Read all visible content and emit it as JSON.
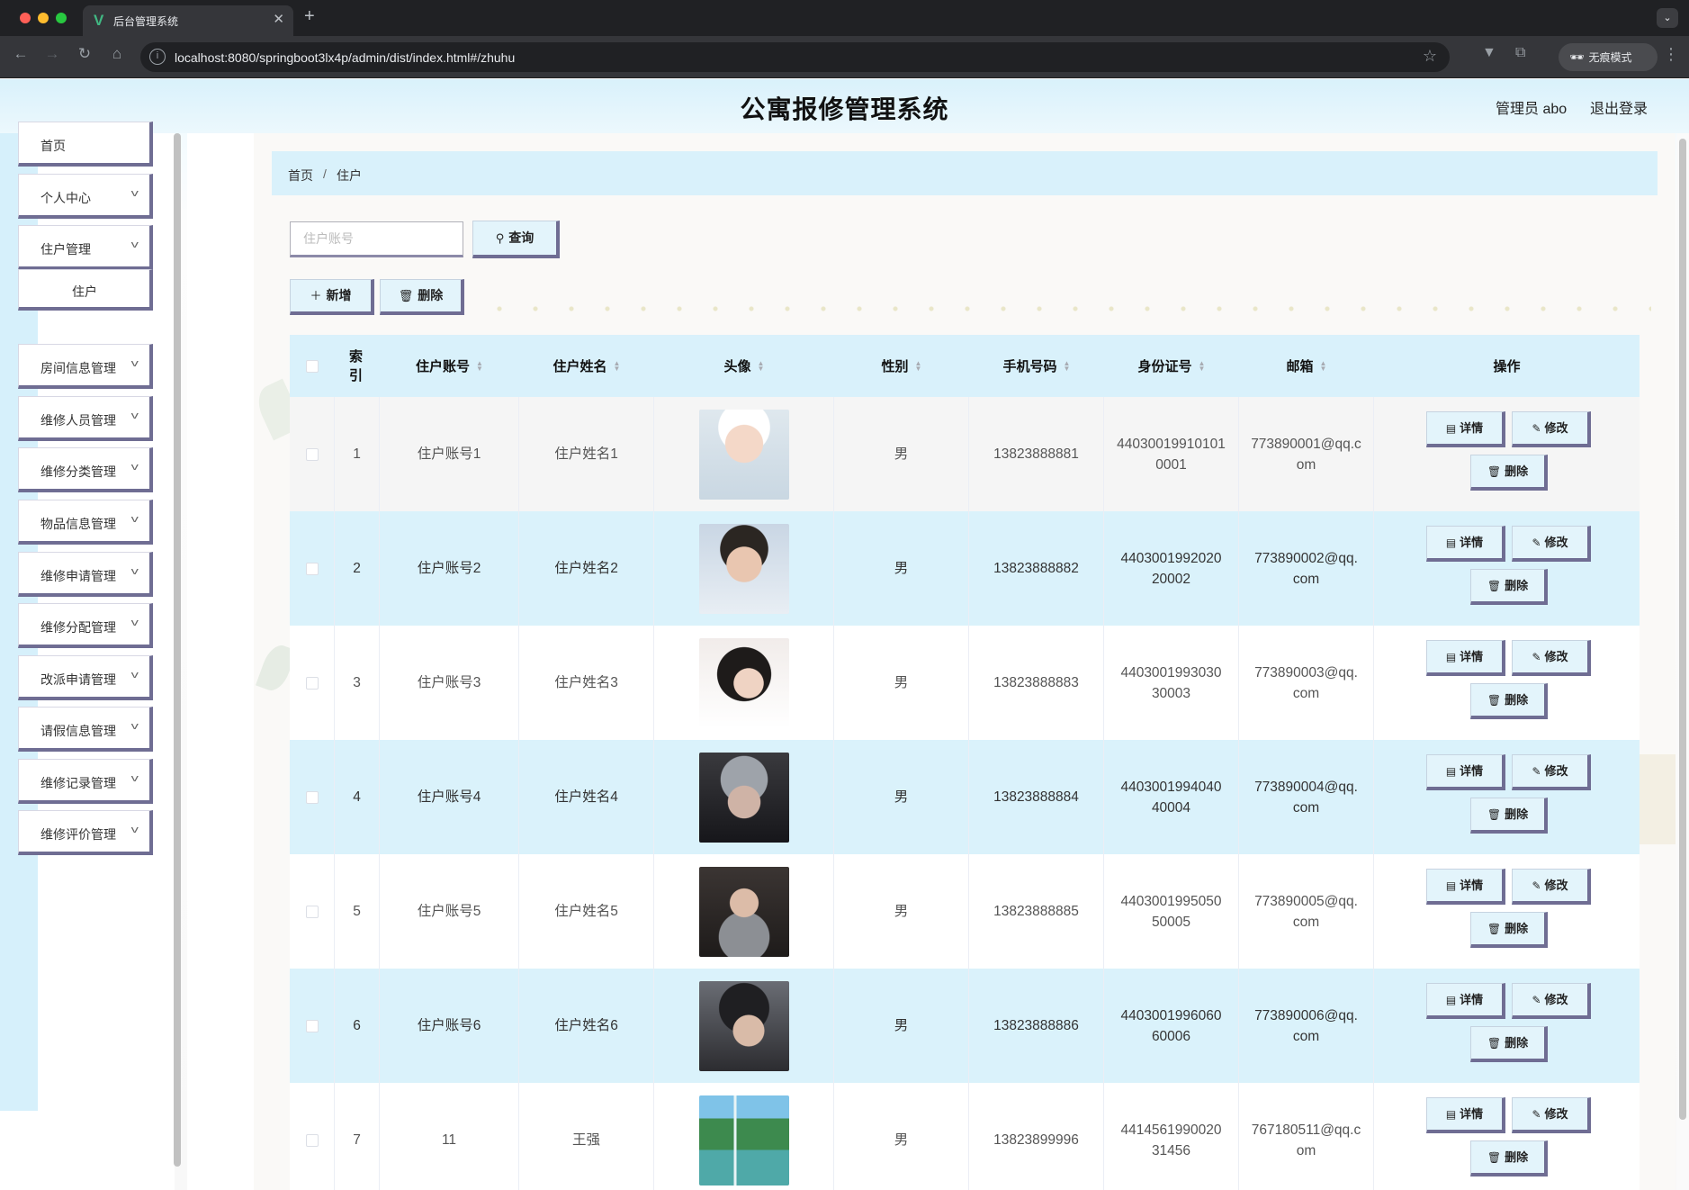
{
  "browser": {
    "tab_title": "后台管理系统",
    "url": "localhost:8080/springboot3lx4p/admin/dist/index.html#/zhuhu",
    "incognito_label": "无痕模式"
  },
  "header": {
    "title": "公寓报修管理系统",
    "user": "管理员 abo",
    "logout": "退出登录"
  },
  "sidebar": {
    "items": [
      {
        "label": "首页"
      },
      {
        "label": "个人中心"
      },
      {
        "label": "住户管理"
      },
      {
        "label": "住户"
      },
      {
        "label": "房间信息管理"
      },
      {
        "label": "维修人员管理"
      },
      {
        "label": "维修分类管理"
      },
      {
        "label": "物品信息管理"
      },
      {
        "label": "维修申请管理"
      },
      {
        "label": "维修分配管理"
      },
      {
        "label": "改派申请管理"
      },
      {
        "label": "请假信息管理"
      },
      {
        "label": "维修记录管理"
      },
      {
        "label": "维修评价管理"
      }
    ]
  },
  "breadcrumb": {
    "home": "首页",
    "sep": "/",
    "current": "住户"
  },
  "search": {
    "placeholder": "住户账号",
    "query_label": "查询"
  },
  "actions": {
    "add_label": "新增",
    "delete_label": "删除"
  },
  "table": {
    "headers": {
      "index": "索引",
      "account": "住户账号",
      "name": "住户姓名",
      "avatar": "头像",
      "gender": "性别",
      "phone": "手机号码",
      "id_card": "身份证号",
      "email": "邮箱",
      "ops": "操作"
    },
    "op_labels": {
      "detail": "详情",
      "edit": "修改",
      "delete": "删除"
    },
    "rows": [
      {
        "index": "1",
        "account": "住户账号1",
        "name": "住户姓名1",
        "gender": "男",
        "phone": "13823888881",
        "id_card_l1": "44030019910101",
        "id_card_l2": "0001",
        "email_l1": "773890001@qq.c",
        "email_l2": "om"
      },
      {
        "index": "2",
        "account": "住户账号2",
        "name": "住户姓名2",
        "gender": "男",
        "phone": "13823888882",
        "id_card_l1": "4403001992020",
        "id_card_l2": "20002",
        "email_l1": "773890002@qq.",
        "email_l2": "com"
      },
      {
        "index": "3",
        "account": "住户账号3",
        "name": "住户姓名3",
        "gender": "男",
        "phone": "13823888883",
        "id_card_l1": "4403001993030",
        "id_card_l2": "30003",
        "email_l1": "773890003@qq.",
        "email_l2": "com"
      },
      {
        "index": "4",
        "account": "住户账号4",
        "name": "住户姓名4",
        "gender": "男",
        "phone": "13823888884",
        "id_card_l1": "4403001994040",
        "id_card_l2": "40004",
        "email_l1": "773890004@qq.",
        "email_l2": "com"
      },
      {
        "index": "5",
        "account": "住户账号5",
        "name": "住户姓名5",
        "gender": "男",
        "phone": "13823888885",
        "id_card_l1": "4403001995050",
        "id_card_l2": "50005",
        "email_l1": "773890005@qq.",
        "email_l2": "com"
      },
      {
        "index": "6",
        "account": "住户账号6",
        "name": "住户姓名6",
        "gender": "男",
        "phone": "13823888886",
        "id_card_l1": "4403001996060",
        "id_card_l2": "60006",
        "email_l1": "773890006@qq.",
        "email_l2": "com"
      },
      {
        "index": "7",
        "account": "11",
        "name": "王强",
        "gender": "男",
        "phone": "13823899996",
        "id_card_l1": "4414561990020",
        "id_card_l2": "31456",
        "email_l1": "767180511@qq.c",
        "email_l2": "om"
      }
    ]
  }
}
